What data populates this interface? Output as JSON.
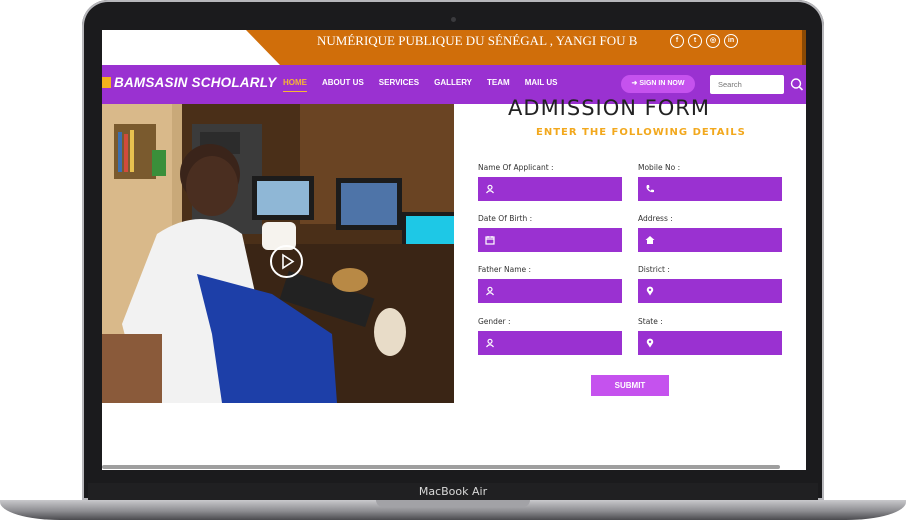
{
  "device": {
    "label": "MacBook Air"
  },
  "top_bar": {
    "marquee_text": "NUMÉRIQUE PUBLIQUE DU SÉNÉGAL , YANGI FOU B",
    "socials": [
      "facebook-icon",
      "twitter-icon",
      "instagram-icon",
      "linkedin-icon"
    ],
    "accent_color": "#d06e0a"
  },
  "navbar": {
    "brand": "BAMSASIN SCHOLARLY",
    "items": [
      {
        "label": "HOME",
        "active": true
      },
      {
        "label": "ABOUT US"
      },
      {
        "label": "SERVICES"
      },
      {
        "label": "GALLERY"
      },
      {
        "label": "TEAM"
      },
      {
        "label": "MAIL US"
      }
    ],
    "signin_label": "SIGN IN NOW",
    "search_placeholder": "Search",
    "bg_color": "#9a31d1"
  },
  "form": {
    "title": "ADMISSION FORM",
    "subtitle": "ENTER THE FOLLOWING DETAILS",
    "fields": [
      {
        "label": "Name Of Applicant :",
        "icon": "user-icon"
      },
      {
        "label": "Mobile No :",
        "icon": "phone-icon"
      },
      {
        "label": "Date Of Birth :",
        "icon": "calendar-icon"
      },
      {
        "label": "Address :",
        "icon": "home-icon"
      },
      {
        "label": "Father Name :",
        "icon": "user-icon"
      },
      {
        "label": "District :",
        "icon": "map-marker-icon"
      },
      {
        "label": "Gender :",
        "icon": "user-icon"
      },
      {
        "label": "State :",
        "icon": "map-marker-icon"
      }
    ],
    "submit_label": "SUBMIT"
  }
}
